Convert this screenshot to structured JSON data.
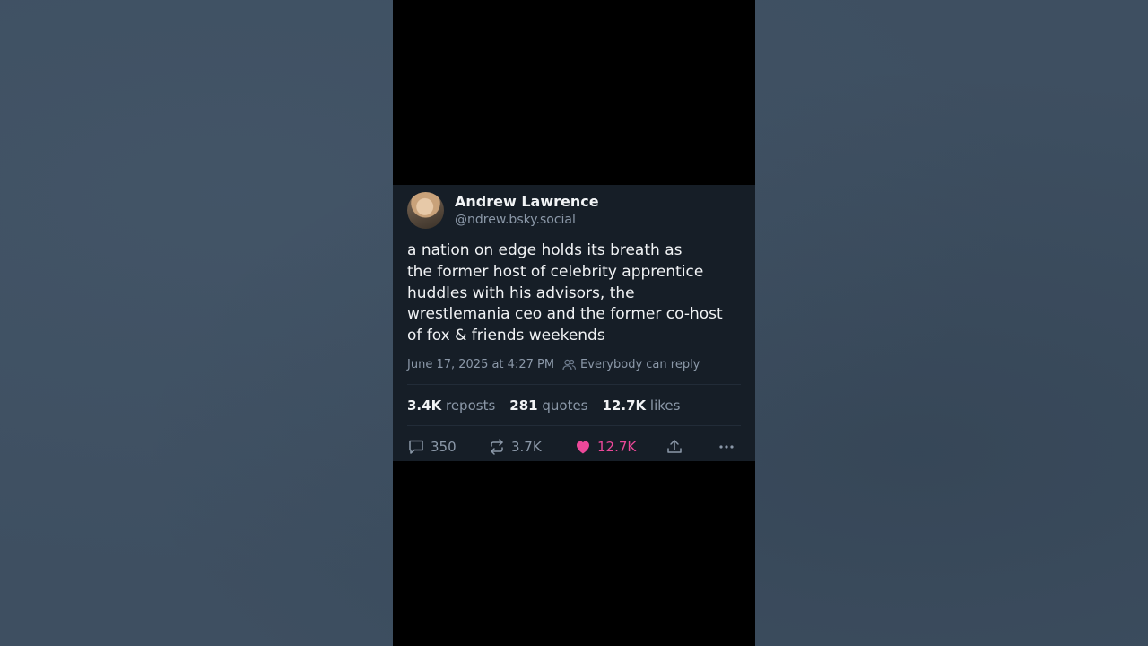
{
  "post": {
    "author_name": "Andrew Lawrence",
    "author_handle": "@ndrew.bsky.social",
    "text": "a nation on edge holds its breath as\nthe former host of celebrity apprentice\nhuddles with his advisors, the\nwrestlemania ceo and the former co-host\nof fox & friends weekends",
    "timestamp": "June 17, 2025 at 4:27 PM",
    "reply_setting": "Everybody can reply"
  },
  "stats": {
    "reposts_count": "3.4K",
    "reposts_label": "reposts",
    "quotes_count": "281",
    "quotes_label": "quotes",
    "likes_count": "12.7K",
    "likes_label": "likes"
  },
  "actions": {
    "reply_count": "350",
    "repost_count": "3.7K",
    "like_count": "12.7K",
    "like_color": "#ec4899",
    "icons": [
      "reply-icon",
      "repost-icon",
      "heart-icon",
      "share-icon",
      "more-icon"
    ]
  },
  "colors": {
    "background": "#3e4f61",
    "card": "#161e27",
    "text": "#f1f3f5",
    "muted": "#8b98a8"
  }
}
